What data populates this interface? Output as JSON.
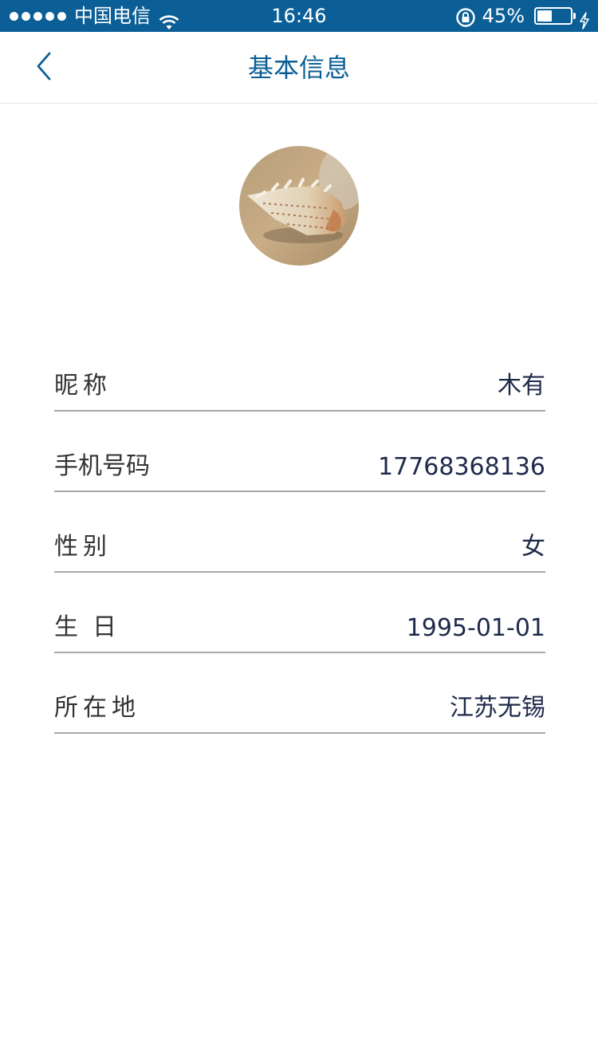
{
  "status_bar": {
    "carrier": "中国电信",
    "time": "16:46",
    "battery_percent_text": "45%",
    "battery_level": 0.45,
    "signal_dots": 5
  },
  "nav": {
    "title": "基本信息",
    "back_icon": "chevron-left-icon"
  },
  "profile": {
    "avatar_subject": "seashell-on-sand"
  },
  "info": {
    "rows": [
      {
        "label": "昵称",
        "value": "木有"
      },
      {
        "label": "手机号码",
        "value": "17768368136"
      },
      {
        "label": "性别",
        "value": "女"
      },
      {
        "label": "生日",
        "value": "1995-01-01"
      },
      {
        "label": "所在地",
        "value": "江苏无锡"
      }
    ]
  },
  "colors": {
    "status_bar_bg": "#0b5f96",
    "accent": "#0b5f96",
    "divider": "#a8a8a8",
    "label_text": "#333333",
    "value_text": "#1e2a4a"
  }
}
